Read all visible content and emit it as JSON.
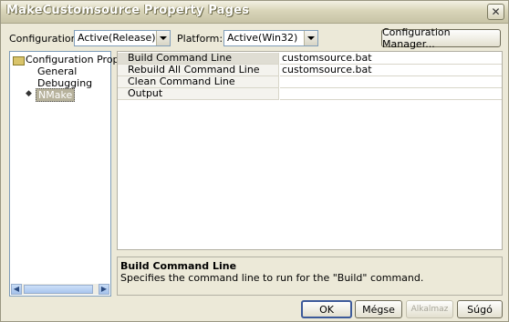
{
  "window": {
    "title": "MakeCustomsource Property Pages",
    "close_glyph": "✕"
  },
  "toolbar": {
    "configuration_label": "Configuration:",
    "configuration_value": "Active(Release)",
    "platform_label": "Platform:",
    "platform_value": "Active(Win32)",
    "config_manager_label": "Configuration Manager..."
  },
  "tree": {
    "root": "Configuration Prope",
    "items": [
      {
        "label": "General"
      },
      {
        "label": "Debugging"
      },
      {
        "label": "NMake"
      }
    ],
    "selected_marker": "◆"
  },
  "grid": {
    "rows": [
      {
        "name": "Build Command Line",
        "value": "customsource.bat"
      },
      {
        "name": "Rebuild All Command Line",
        "value": "customsource.bat"
      },
      {
        "name": "Clean Command Line",
        "value": ""
      },
      {
        "name": "Output",
        "value": ""
      }
    ]
  },
  "description": {
    "title": "Build Command Line",
    "text": "Specifies the command line to run for the \"Build\" command."
  },
  "buttons": {
    "ok": "OK",
    "cancel": "Mégse",
    "apply": "Alkalmaz",
    "help": "Súgó"
  },
  "icons": {
    "close": "close-icon",
    "folder": "folder-icon",
    "dropdown": "chevron-down-icon"
  }
}
